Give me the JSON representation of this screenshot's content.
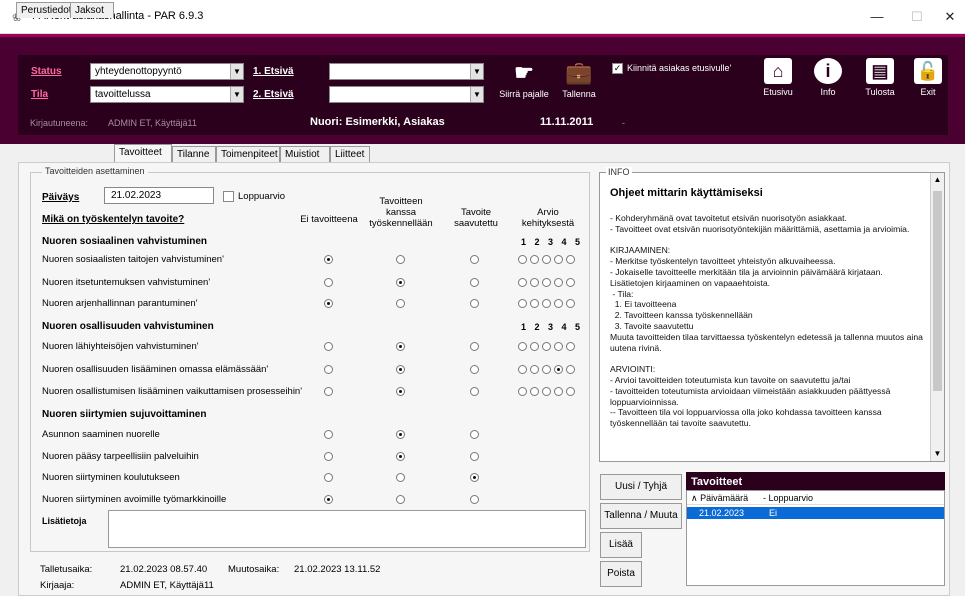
{
  "window": {
    "title": "PARent asiakashallinta - PAR 6.9.3",
    "minimize": "—",
    "maximize": "☐",
    "close": "✕"
  },
  "header": {
    "status_label": "Status",
    "status_value": "yhteydenottopyyntö",
    "tila_label": "Tila",
    "tila_value": "tavoittelussa",
    "etsiva1_label": "1. Etsivä",
    "etsiva2_label": "2. Etsivä",
    "etsiva1_value": "",
    "etsiva2_value": "",
    "siirra_label": "Siirrä pajalle",
    "tallenna_label": "Tallenna",
    "pin_label": "Kiinnitä asiakas etusivulle'",
    "etusivu_label": "Etusivu",
    "info_label": "Info",
    "tulosta_label": "Tulosta",
    "exit_label": "Exit",
    "kirjautuneena_label": "Kirjautuneena:",
    "kirjautuneena_value": "ADMIN ET, Käyttäjä11",
    "nuori_label": "Nuori: Esimerkki, Asiakas",
    "date": "11.11.2011",
    "date_suffix": "-"
  },
  "tabs": [
    "Perustiedot",
    "Jaksot",
    "Tavoitteet",
    "Tilanne",
    "Toimenpiteet",
    "Muistiot",
    "Liitteet"
  ],
  "form": {
    "legend": "Tavoitteiden asettaminen",
    "paivays_label": "Päiväys",
    "paivays_value": "21.02.2023",
    "loppuarvio_label": "Loppuarvio",
    "question": "Mikä on työskentelyn tavoite?",
    "col_ei": "Ei tavoitteena",
    "col_kanssa_1": "Tavoitteen",
    "col_kanssa_2": "kanssa",
    "col_kanssa_3": "työskennellään",
    "col_saavutettu_1": "Tavoite",
    "col_saavutettu_2": "saavutettu",
    "col_arvio_1": "Arvio",
    "col_arvio_2": "kehityksestä",
    "scale": "1 2 3 4 5",
    "sections": [
      {
        "title": "Nuoren sosiaalinen vahvistuminen",
        "items": [
          "Nuoren sosiaalisten taitojen vahvistuminen'",
          "Nuoren itsetuntemuksen vahvistuminen'",
          "Nuoren arjenhallinnan parantuminen'"
        ]
      },
      {
        "title": "Nuoren osallisuuden vahvistuminen",
        "items": [
          "Nuoren lähiyhteisöjen vahvistuminen'",
          "Nuoren osallisuuden lisääminen omassa elämässään'",
          "Nuoren osallistumisen lisääminen vaikuttamisen prosesseihin'"
        ]
      },
      {
        "title": "Nuoren siirtymien sujuvoittaminen",
        "items": [
          "Asunnon saaminen nuorelle",
          "Nuoren pääsy tarpeellisiin palveluihin",
          "Nuoren siirtyminen koulutukseen",
          "Nuoren siirtyminen avoimille työmarkkinoille"
        ]
      }
    ],
    "lisatietoja_label": "Lisätietoja"
  },
  "footer": {
    "talletusaika_label": "Talletusaika:",
    "talletusaika_value": "21.02.2023 08.57.40",
    "muutosaika_label": "Muutosaika:",
    "muutosaika_value": "21.02.2023 13.11.52",
    "kirjaaja_label": "Kirjaaja:",
    "kirjaaja_value": "ADMIN ET, Käyttäjä11"
  },
  "info": {
    "legend": "INFO",
    "title": "Ohjeet mittarin käyttämiseksi",
    "text": "- Kohderyhmänä ovat tavoitetut etsivän nuorisotyön asiakkaat.\n- Tavoitteet ovat etsivän nuorisotyöntekijän määrittämiä, asettamia ja arvioimia.\n\nKIRJAAMINEN:\n- Merkitse työskentelyn tavoitteet yhteistyön alkuvaiheessa.\n- Jokaiselle tavoitteelle merkitään tila ja arvioinnin päivämäärä kirjataan.\nLisätietojen kirjaaminen on vapaaehtoista.\n - Tila:\n  1. Ei tavoitteena\n  2. Tavoitteen kanssa työskennellään\n  3. Tavoite saavutettu\nMuuta tavoitteiden tilaa tarvittaessa työskentelyn edetessä ja tallenna muutos aina uutena rivinä.\n\nARVIOINTI:\n- Arvioi tavoitteiden toteutumista kun tavoite on saavutettu ja/tai\n- tavoitteiden toteutumista arvioidaan viimeistään asiakkuuden päättyessä loppuarvioinnissa.\n-- Tavoitteen tila voi loppuarviossa olla joko kohdassa tavoitteen kanssa työskennellään tai tavoite saavutettu."
  },
  "buttons": {
    "uusi": "Uusi / Tyhjä",
    "tallenna_muuta": "Tallenna / Muuta",
    "lisaa": "Lisää",
    "poista": "Poista"
  },
  "tavoitteet_list": {
    "title": "Tavoitteet",
    "col1": "∧ Päivämäärä",
    "col2": "- Loppuarvio",
    "rows": [
      {
        "date": "21.02.2023",
        "value": "Ei"
      }
    ]
  }
}
